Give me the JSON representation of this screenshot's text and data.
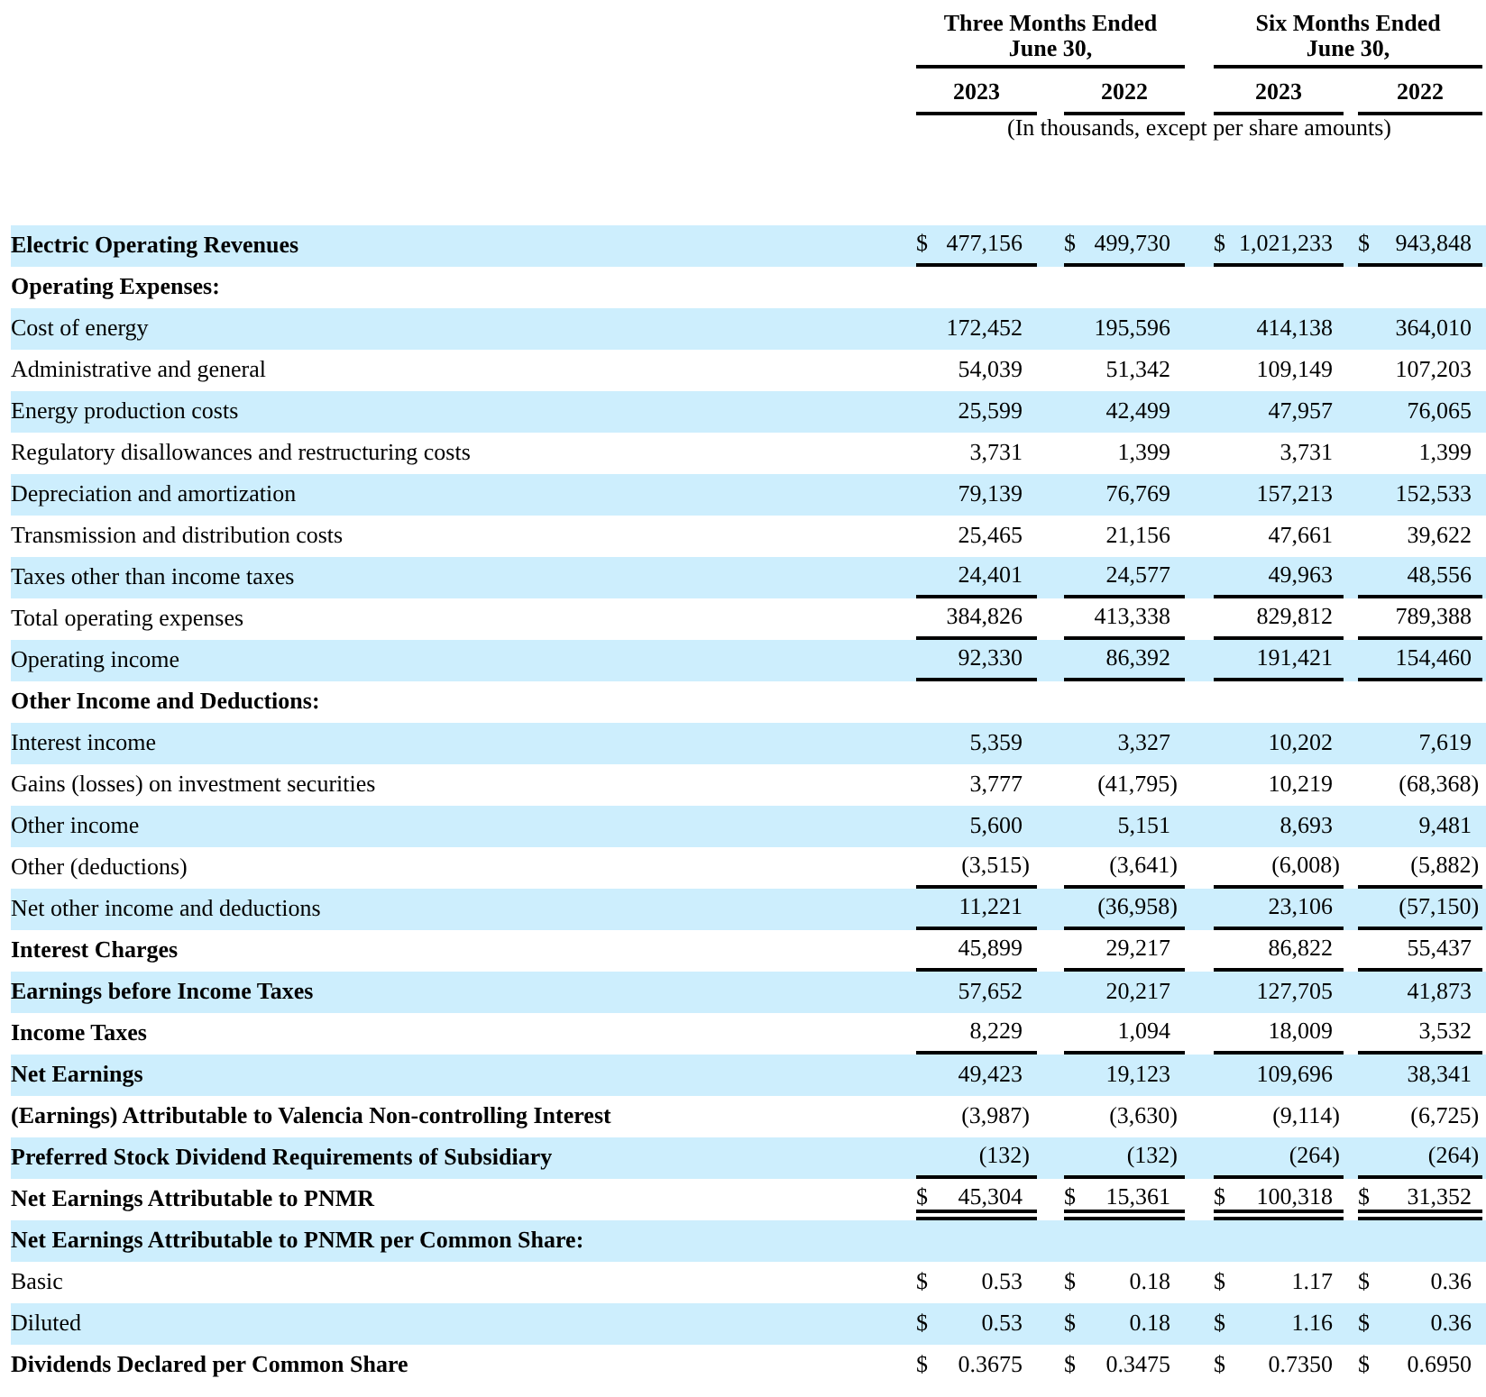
{
  "header": {
    "column_groups": [
      {
        "lines": [
          "Three Months Ended",
          "June 30,"
        ]
      },
      {
        "lines": [
          "Six Months Ended",
          "June 30,"
        ]
      }
    ],
    "years": [
      "2023",
      "2022",
      "2023",
      "2022"
    ],
    "units_note": "(In thousands, except per share amounts)"
  },
  "rows": [
    {
      "kind": "section",
      "label": "Electric Operating Revenues",
      "underlined": true,
      "double_underlined": false,
      "values": [
        {
          "symbol": "$",
          "amount": "477,156"
        },
        {
          "symbol": "$",
          "amount": "499,730"
        },
        {
          "symbol": "$",
          "amount": "1,021,233"
        },
        {
          "symbol": "$",
          "amount": "943,848"
        }
      ]
    },
    {
      "kind": "section",
      "label": "Operating Expenses:",
      "values": []
    },
    {
      "kind": "item",
      "label": "Cost of energy",
      "underlined": false,
      "double_underlined": false,
      "values": [
        {
          "amount": "172,452"
        },
        {
          "amount": "195,596"
        },
        {
          "amount": "414,138"
        },
        {
          "amount": "364,010"
        }
      ]
    },
    {
      "kind": "item",
      "label": "Administrative and general",
      "underlined": false,
      "double_underlined": false,
      "values": [
        {
          "amount": "54,039"
        },
        {
          "amount": "51,342"
        },
        {
          "amount": "109,149"
        },
        {
          "amount": "107,203"
        }
      ]
    },
    {
      "kind": "item",
      "label": "Energy production costs",
      "underlined": false,
      "double_underlined": false,
      "values": [
        {
          "amount": "25,599"
        },
        {
          "amount": "42,499"
        },
        {
          "amount": "47,957"
        },
        {
          "amount": "76,065"
        }
      ]
    },
    {
      "kind": "item",
      "label": "Regulatory disallowances and restructuring costs",
      "underlined": false,
      "double_underlined": false,
      "values": [
        {
          "amount": "3,731"
        },
        {
          "amount": "1,399"
        },
        {
          "amount": "3,731"
        },
        {
          "amount": "1,399"
        }
      ]
    },
    {
      "kind": "item",
      "label": "Depreciation and amortization",
      "underlined": false,
      "double_underlined": false,
      "values": [
        {
          "amount": "79,139"
        },
        {
          "amount": "76,769"
        },
        {
          "amount": "157,213"
        },
        {
          "amount": "152,533"
        }
      ]
    },
    {
      "kind": "item",
      "label": "Transmission and distribution costs",
      "underlined": false,
      "double_underlined": false,
      "values": [
        {
          "amount": "25,465"
        },
        {
          "amount": "21,156"
        },
        {
          "amount": "47,661"
        },
        {
          "amount": "39,622"
        }
      ]
    },
    {
      "kind": "item",
      "label": "Taxes other than income taxes",
      "underlined": true,
      "double_underlined": false,
      "values": [
        {
          "amount": "24,401"
        },
        {
          "amount": "24,577"
        },
        {
          "amount": "49,963"
        },
        {
          "amount": "48,556"
        }
      ]
    },
    {
      "kind": "total",
      "label": "Total operating expenses",
      "underlined": true,
      "double_underlined": false,
      "values": [
        {
          "amount": "384,826"
        },
        {
          "amount": "413,338"
        },
        {
          "amount": "829,812"
        },
        {
          "amount": "789,388"
        }
      ]
    },
    {
      "kind": "total",
      "label": "Operating income",
      "underlined": true,
      "double_underlined": false,
      "values": [
        {
          "amount": "92,330"
        },
        {
          "amount": "86,392"
        },
        {
          "amount": "191,421"
        },
        {
          "amount": "154,460"
        }
      ]
    },
    {
      "kind": "section",
      "label": "Other Income and Deductions:",
      "values": []
    },
    {
      "kind": "item",
      "label": "Interest income",
      "underlined": false,
      "double_underlined": false,
      "values": [
        {
          "amount": "5,359"
        },
        {
          "amount": "3,327"
        },
        {
          "amount": "10,202"
        },
        {
          "amount": "7,619"
        }
      ]
    },
    {
      "kind": "item",
      "label": "Gains (losses) on investment securities",
      "underlined": false,
      "double_underlined": false,
      "values": [
        {
          "amount": "3,777"
        },
        {
          "amount": "(41,795)"
        },
        {
          "amount": "10,219"
        },
        {
          "amount": "(68,368)"
        }
      ]
    },
    {
      "kind": "item",
      "label": "Other income",
      "underlined": false,
      "double_underlined": false,
      "values": [
        {
          "amount": "5,600"
        },
        {
          "amount": "5,151"
        },
        {
          "amount": "8,693"
        },
        {
          "amount": "9,481"
        }
      ]
    },
    {
      "kind": "item",
      "label": "Other (deductions)",
      "underlined": true,
      "double_underlined": false,
      "values": [
        {
          "amount": "(3,515)"
        },
        {
          "amount": "(3,641)"
        },
        {
          "amount": "(6,008)"
        },
        {
          "amount": "(5,882)"
        }
      ]
    },
    {
      "kind": "total",
      "label": "Net other income and deductions",
      "underlined": true,
      "double_underlined": false,
      "values": [
        {
          "amount": "11,221"
        },
        {
          "amount": "(36,958)"
        },
        {
          "amount": "23,106"
        },
        {
          "amount": "(57,150)"
        }
      ]
    },
    {
      "kind": "section",
      "label": "Interest Charges",
      "underlined": true,
      "double_underlined": false,
      "values": [
        {
          "amount": "45,899"
        },
        {
          "amount": "29,217"
        },
        {
          "amount": "86,822"
        },
        {
          "amount": "55,437"
        }
      ]
    },
    {
      "kind": "section",
      "label": "Earnings before Income Taxes",
      "underlined": false,
      "double_underlined": false,
      "values": [
        {
          "amount": "57,652"
        },
        {
          "amount": "20,217"
        },
        {
          "amount": "127,705"
        },
        {
          "amount": "41,873"
        }
      ]
    },
    {
      "kind": "section",
      "label": "Income Taxes",
      "underlined": true,
      "double_underlined": false,
      "values": [
        {
          "amount": "8,229"
        },
        {
          "amount": "1,094"
        },
        {
          "amount": "18,009"
        },
        {
          "amount": "3,532"
        }
      ]
    },
    {
      "kind": "section",
      "label": "Net Earnings",
      "underlined": false,
      "double_underlined": false,
      "values": [
        {
          "amount": "49,423"
        },
        {
          "amount": "19,123"
        },
        {
          "amount": "109,696"
        },
        {
          "amount": "38,341"
        }
      ]
    },
    {
      "kind": "section",
      "label": "(Earnings) Attributable to Valencia Non-controlling Interest",
      "underlined": false,
      "double_underlined": false,
      "values": [
        {
          "amount": "(3,987)"
        },
        {
          "amount": "(3,630)"
        },
        {
          "amount": "(9,114)"
        },
        {
          "amount": "(6,725)"
        }
      ]
    },
    {
      "kind": "section",
      "label": "Preferred Stock Dividend Requirements of Subsidiary",
      "underlined": true,
      "double_underlined": false,
      "values": [
        {
          "amount": "(132)"
        },
        {
          "amount": "(132)"
        },
        {
          "amount": "(264)"
        },
        {
          "amount": "(264)"
        }
      ]
    },
    {
      "kind": "section",
      "label": "Net Earnings Attributable to PNMR",
      "underlined": true,
      "double_underlined": true,
      "values": [
        {
          "symbol": "$",
          "amount": "45,304"
        },
        {
          "symbol": "$",
          "amount": "15,361"
        },
        {
          "symbol": "$",
          "amount": "100,318"
        },
        {
          "symbol": "$",
          "amount": "31,352"
        }
      ]
    },
    {
      "kind": "section",
      "label": "Net Earnings Attributable to PNMR per Common Share:",
      "values": []
    },
    {
      "kind": "total",
      "label": "Basic",
      "underlined": false,
      "double_underlined": false,
      "values": [
        {
          "symbol": "$",
          "amount": "0.53"
        },
        {
          "symbol": "$",
          "amount": "0.18"
        },
        {
          "symbol": "$",
          "amount": "1.17"
        },
        {
          "symbol": "$",
          "amount": "0.36"
        }
      ]
    },
    {
      "kind": "total",
      "label": "Diluted",
      "underlined": false,
      "double_underlined": false,
      "values": [
        {
          "symbol": "$",
          "amount": "0.53"
        },
        {
          "symbol": "$",
          "amount": "0.18"
        },
        {
          "symbol": "$",
          "amount": "1.16"
        },
        {
          "symbol": "$",
          "amount": "0.36"
        }
      ]
    },
    {
      "kind": "section",
      "label": "Dividends Declared per Common Share",
      "underlined": false,
      "double_underlined": false,
      "values": [
        {
          "symbol": "$",
          "amount": "0.3675"
        },
        {
          "symbol": "$",
          "amount": "0.3475"
        },
        {
          "symbol": "$",
          "amount": "0.7350"
        },
        {
          "symbol": "$",
          "amount": "0.6950"
        }
      ]
    }
  ]
}
